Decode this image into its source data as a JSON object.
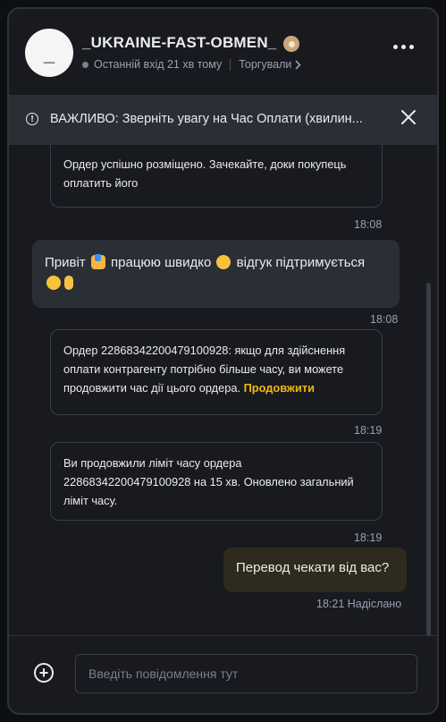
{
  "header": {
    "avatar_initial": "_",
    "username": "_UKRAINE-FAST-OBMEN_",
    "last_seen": "Останній вхід 21 хв тому",
    "traded_label": "Торгували",
    "badge_icon": "shield-badge-icon",
    "more_icon": "more-dots-icon"
  },
  "notice": {
    "text": "ВАЖЛИВО: Зверніть увагу на Час Оплати (хвилин...",
    "icon": "alert-circle-icon",
    "close_icon": "close-icon"
  },
  "messages": [
    {
      "type": "system",
      "text": "Ордер успішно розміщено. Зачекайте, доки покупець оплатить його",
      "time": "18:08"
    },
    {
      "type": "incoming",
      "text_before": "Привіт",
      "text_mid": "працюю швидко",
      "text_after": "відгук підтримується",
      "time": "18:08"
    },
    {
      "type": "system",
      "text": "Ордер 22868342200479100928: якщо для здійснення оплати контрагенту потрібно більше часу, ви можете продовжити час дії цього ордера.",
      "link": "Продовжити",
      "time": "18:19"
    },
    {
      "type": "system",
      "text": "Ви продовжили ліміт часу ордера 22868342200479100928 на 15 хв. Оновлено загальний ліміт часу.",
      "time": "18:19"
    },
    {
      "type": "outgoing",
      "text": "Перевод чекати від вас?",
      "time": "18:21",
      "status": "Надіслано"
    }
  ],
  "composer": {
    "placeholder": "Введіть повідомлення тут",
    "value": "",
    "add_icon": "plus-circle-icon"
  },
  "colors": {
    "background": "#181a20",
    "accent": "#f0b90b",
    "incoming_bubble": "#2a2e35",
    "outgoing_bubble": "#2f2a1e"
  }
}
